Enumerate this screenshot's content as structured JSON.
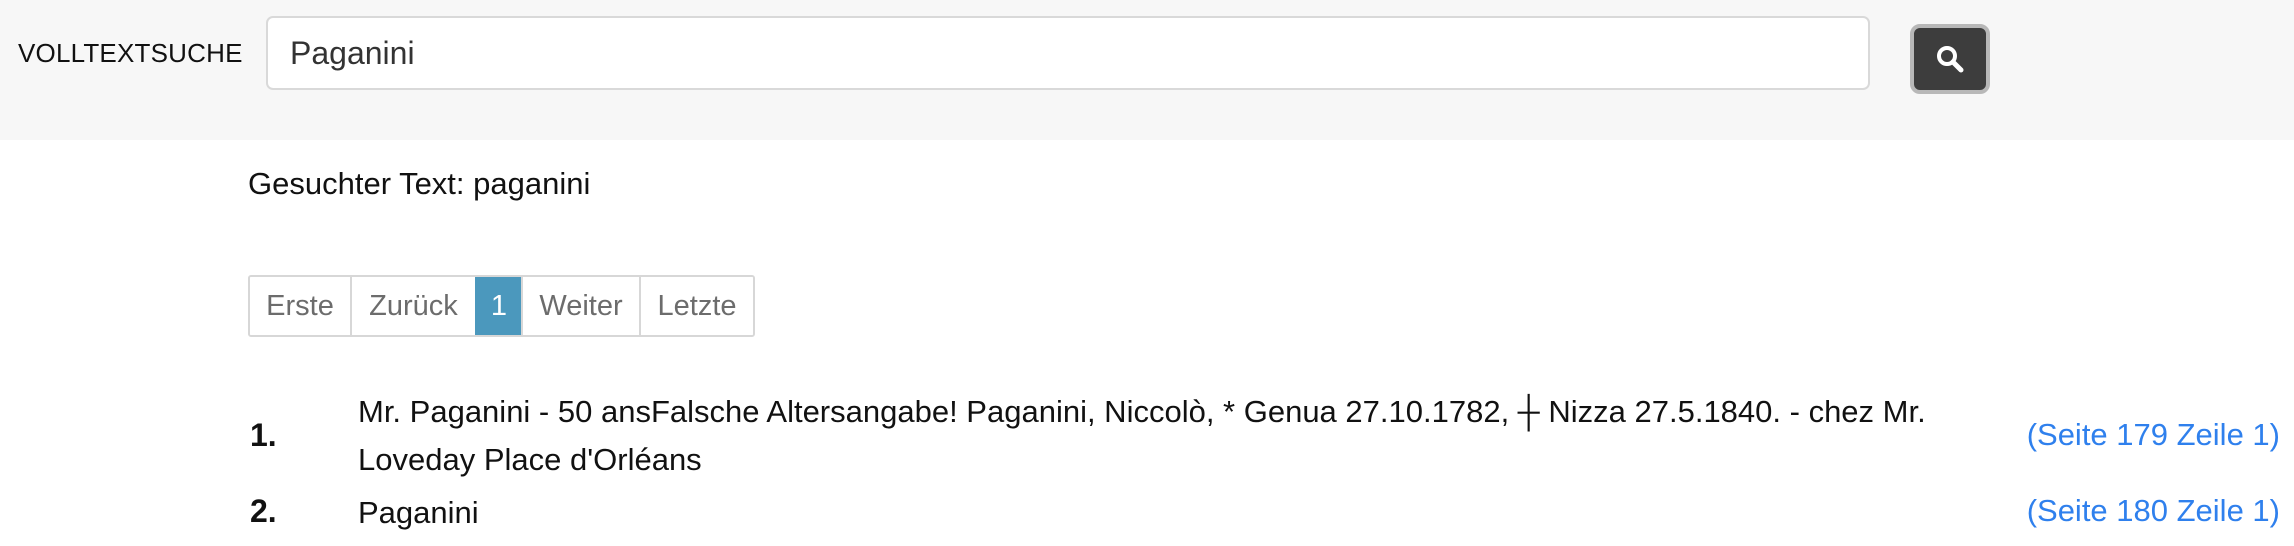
{
  "search": {
    "label": "VOLLTEXTSUCHE",
    "value": "Paganini",
    "placeholder": "",
    "button_icon": "search-icon"
  },
  "query": {
    "text": "Gesuchter Text: paganini"
  },
  "pagination": {
    "first": "Erste",
    "prev": "Zurück",
    "current": "1",
    "next": "Weiter",
    "last": "Letzte"
  },
  "results": [
    {
      "num": "1.",
      "text": "Mr. Paganini - 50 ansFalsche Altersangabe! Paganini, Niccolò, * Genua 27.10.1782, ┼ Nizza 27.5.1840. - chez Mr. Loveday Place d'Orléans",
      "link": "(Seite 179 Zeile 1)"
    },
    {
      "num": "2.",
      "text": "Paganini",
      "link": "(Seite 180 Zeile 1)"
    }
  ],
  "colors": {
    "topbar_bg": "#f7f7f7",
    "button_bg": "#3d3d3d",
    "active_page": "#4b98bd",
    "link": "#2f80ed"
  }
}
